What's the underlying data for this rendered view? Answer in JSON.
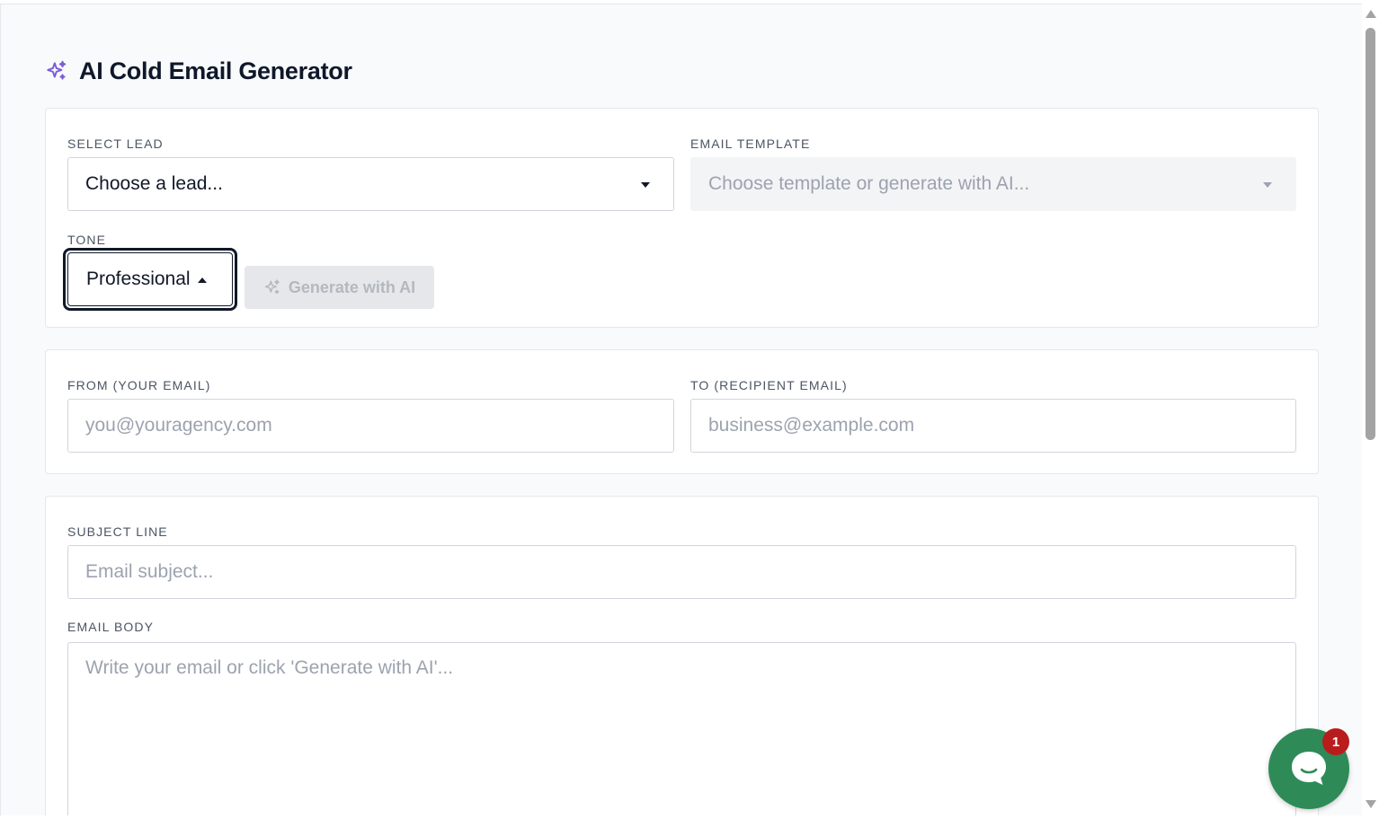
{
  "page": {
    "title": "AI Cold Email Generator",
    "title_icon": "sparkles-icon",
    "accent_color": "#7c5cd6"
  },
  "lead_section": {
    "select_lead_label": "SELECT LEAD",
    "select_lead_value": "Choose a lead...",
    "template_label": "EMAIL TEMPLATE",
    "template_placeholder": "Choose template or generate with AI...",
    "tone_label": "TONE",
    "tone_value": "Professional",
    "generate_button_label": "Generate with AI"
  },
  "email_section": {
    "from_label": "FROM (YOUR EMAIL)",
    "from_placeholder": "you@youragency.com",
    "to_label": "TO (RECIPIENT EMAIL)",
    "to_placeholder": "business@example.com"
  },
  "content_section": {
    "subject_label": "SUBJECT LINE",
    "subject_placeholder": "Email subject...",
    "body_label": "EMAIL BODY",
    "body_placeholder": "Write your email or click 'Generate with AI'..."
  },
  "chat_widget": {
    "icon": "chat-bubble-icon",
    "badge_count": "1",
    "color": "#2e8b57",
    "badge_color": "#b91c1c"
  }
}
